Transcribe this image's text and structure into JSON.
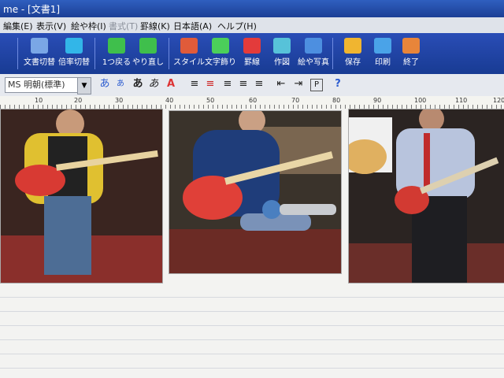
{
  "window": {
    "title": "me - [文書1]"
  },
  "menu": [
    {
      "label": "編集(E)",
      "enabled": true
    },
    {
      "label": "表示(V)",
      "enabled": true
    },
    {
      "label": "絵や枠(I)",
      "enabled": true
    },
    {
      "label": "書式(T)",
      "enabled": false
    },
    {
      "label": "罫線(K)",
      "enabled": true
    },
    {
      "label": "日本語(A)",
      "enabled": true
    },
    {
      "label": "ヘルプ(H)",
      "enabled": true
    }
  ],
  "toolbar": [
    {
      "label": "文書切替",
      "icon": "document-switch-icon",
      "color": "#7aa7e6"
    },
    {
      "label": "倍率切替",
      "icon": "zoom-icon",
      "color": "#32b6e8"
    },
    {
      "label": "1つ戻る",
      "icon": "undo-arrow-icon",
      "color": "#3fbf4c"
    },
    {
      "label": "やり直し",
      "icon": "redo-arrow-icon",
      "color": "#3fbf4c"
    },
    {
      "label": "スタイル",
      "icon": "style-books-icon",
      "color": "#e05b3a"
    },
    {
      "label": "文字飾り",
      "icon": "text-decoration-icon",
      "color": "#4bcf5a"
    },
    {
      "label": "罫線",
      "icon": "ruled-lines-icon",
      "color": "#e33b3b"
    },
    {
      "label": "作図",
      "icon": "drawing-icon",
      "color": "#57c2d9"
    },
    {
      "label": "絵や写真",
      "icon": "picture-icon",
      "color": "#4d8fe0"
    },
    {
      "label": "保存",
      "icon": "save-folder-icon",
      "color": "#f0b530"
    },
    {
      "label": "印刷",
      "icon": "printer-icon",
      "color": "#4aa3e8"
    },
    {
      "label": "終了",
      "icon": "exit-door-icon",
      "color": "#e8853a"
    }
  ],
  "format": {
    "font": "MS 明朝(標準)",
    "buttons": [
      {
        "glyph": "あ",
        "icon": "font-size-up-icon"
      },
      {
        "glyph": "あ",
        "icon": "font-size-down-icon"
      },
      {
        "glyph": "あ",
        "icon": "bold-icon"
      },
      {
        "glyph": "あ",
        "icon": "italic-icon"
      },
      {
        "glyph": "A",
        "icon": "font-color-icon"
      },
      {
        "glyph": "≡",
        "icon": "line-spacing-up-icon"
      },
      {
        "glyph": "≡",
        "icon": "line-spacing-down-icon"
      },
      {
        "glyph": "≡",
        "icon": "align-left-icon"
      },
      {
        "glyph": "≡",
        "icon": "align-center-icon"
      },
      {
        "glyph": "≡",
        "icon": "align-right-icon"
      },
      {
        "glyph": "⇤",
        "icon": "indent-left-icon"
      },
      {
        "glyph": "⇥",
        "icon": "indent-right-icon"
      },
      {
        "glyph": "P",
        "icon": "paragraph-mark-icon"
      },
      {
        "glyph": "?",
        "icon": "help-icon"
      }
    ]
  },
  "ruler": {
    "labels": [
      "10",
      "20",
      "30",
      "40",
      "50",
      "60",
      "70",
      "80",
      "90",
      "100",
      "110",
      "120"
    ]
  }
}
